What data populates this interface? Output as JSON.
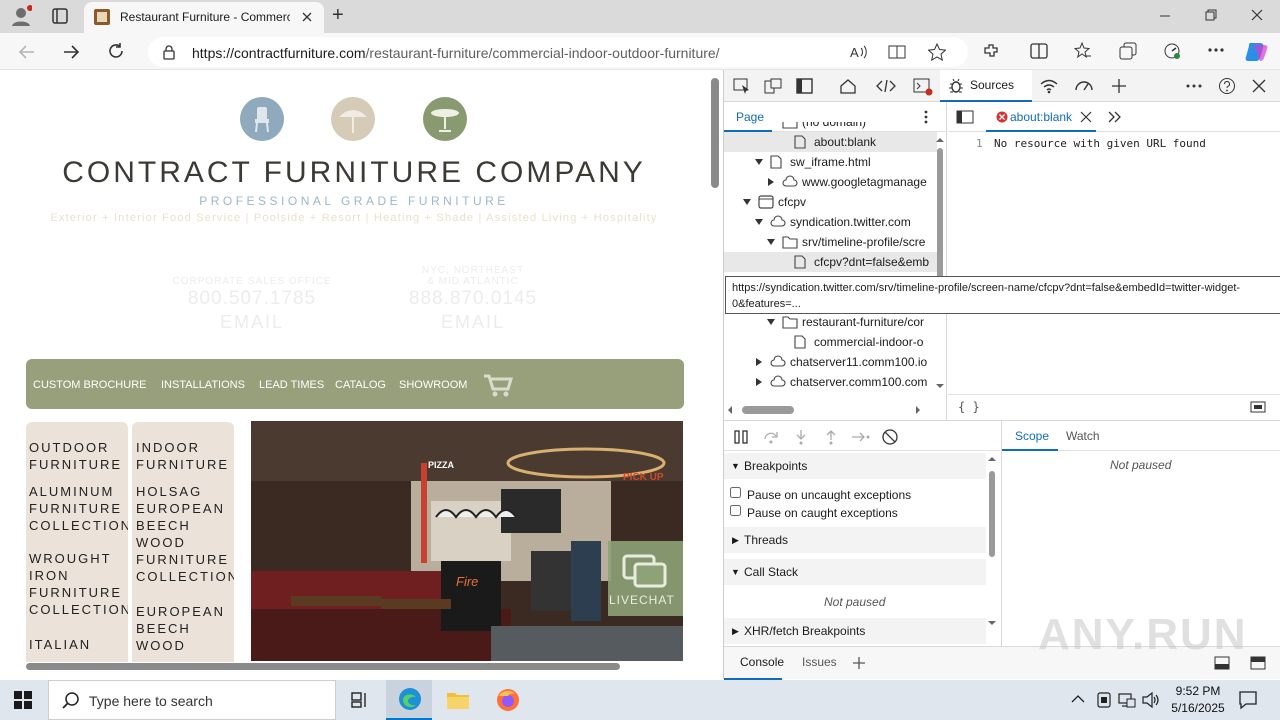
{
  "browser": {
    "tab_title": "Restaurant Furniture - Commercial",
    "url_domain": "https://contractfurniture.com",
    "url_path": "/restaurant-furniture/commercial-indoor-outdoor-furniture/",
    "new_tab": "+"
  },
  "site": {
    "brand": "CONTRACT FURNITURE COMPANY",
    "subtitle": "PROFESSIONAL GRADE FURNITURE",
    "taglines": "Exterior + Interior Food Service | Poolside + Resort | Heating + Shade | Assisted Living + Hospitality",
    "phone_left_label": "CORPORATE SALES OFFICE",
    "phone_left": "800.507.1785",
    "email_left": "EMAIL",
    "phone_right_label1": "NYC, NORTHEAST",
    "phone_right_label2": "& MID ATLANTIC",
    "phone_right": "888.870.0145",
    "email_right": "EMAIL",
    "nav": [
      "CUSTOM BROCHURE",
      "INSTALLATIONS",
      "LEAD TIMES",
      "CATALOG",
      "SHOWROOM"
    ],
    "col_outdoor": [
      "OUTDOOR FURNITURE",
      "ALUMINUM FURNITURE COLLECTIONS",
      "WROUGHT IRON FURNITURE COLLECTIONS",
      "ITALIAN"
    ],
    "col_indoor": [
      "INDOOR FURNITURE",
      "HOLSAG EUROPEAN BEECH WOOD FURNITURE COLLECTION",
      "EUROPEAN BEECH WOOD"
    ],
    "livechat": "LIVECHAT",
    "photo_signs": {
      "pizza": "PIZZA",
      "fire": "Fire",
      "pickup": "PICK UP"
    }
  },
  "devtools": {
    "sources_tab": "Sources",
    "page_tab": "Page",
    "file_tab": "about:blank",
    "tree": [
      {
        "label": "(no domain)",
        "indent": 3,
        "type": "folder"
      },
      {
        "label": "about:blank",
        "indent": 4,
        "type": "file"
      },
      {
        "label": "sw_iframe.html",
        "indent": 2,
        "type": "file",
        "arrow": "down"
      },
      {
        "label": "www.googletagmanage",
        "indent": 3,
        "type": "cloud",
        "arrow": "right"
      },
      {
        "label": "cfcpv",
        "indent": 1,
        "type": "frame",
        "arrow": "down"
      },
      {
        "label": "syndication.twitter.com",
        "indent": 2,
        "type": "cloud",
        "arrow": "down"
      },
      {
        "label": "srv/timeline-profile/scre",
        "indent": 3,
        "type": "folder",
        "arrow": "down"
      },
      {
        "label": "cfcpv?dnt=false&emb",
        "indent": 4,
        "type": "file"
      },
      {
        "label": "",
        "indent": 0,
        "type": "none"
      },
      {
        "label": "",
        "indent": 0,
        "type": "none"
      },
      {
        "label": "restaurant-furniture/cor",
        "indent": 3,
        "type": "folder",
        "arrow": "down"
      },
      {
        "label": "commercial-indoor-o",
        "indent": 4,
        "type": "file"
      },
      {
        "label": "chatserver11.comm100.io",
        "indent": 2,
        "type": "cloud",
        "arrow": "right"
      },
      {
        "label": "chatserver.comm100.com",
        "indent": 2,
        "type": "cloud",
        "arrow": "right"
      }
    ],
    "tooltip": "https://syndication.twitter.com/srv/timeline-profile/screen-name/cfcpv?dnt=false&embedId=twitter-widget-0&features=...",
    "line_number": "1",
    "editor_text": "No resource with given URL found",
    "braces": "{ }",
    "breakpoints": "Breakpoints",
    "pause_uncaught": "Pause on uncaught exceptions",
    "pause_caught": "Pause on caught exceptions",
    "threads": "Threads",
    "call_stack": "Call Stack",
    "not_paused": "Not paused",
    "xhr": "XHR/fetch Breakpoints",
    "scope": "Scope",
    "watch": "Watch",
    "scope_status": "Not paused",
    "console": "Console",
    "issues": "Issues"
  },
  "taskbar": {
    "search_placeholder": "Type here to search",
    "time": "9:52 PM",
    "date": "5/16/2025"
  },
  "watermark": "ANY.RUN"
}
